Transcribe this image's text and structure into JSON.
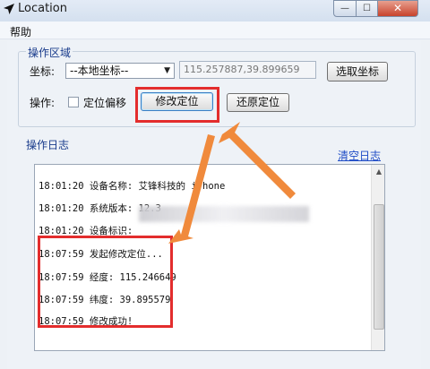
{
  "window": {
    "title": "Location"
  },
  "menu": {
    "help": "帮助"
  },
  "ops": {
    "legend": "操作区域",
    "coord_label": "坐标:",
    "coord_select": "--本地坐标--",
    "coord_value": "115.257887,39.899659",
    "pick_button": "选取坐标",
    "op_label": "操作:",
    "offset_checkbox": "定位偏移",
    "modify_button": "修改定位",
    "restore_button": "还原定位"
  },
  "log": {
    "legend": "操作日志",
    "clear": "清空日志",
    "lines": [
      "18:01:20 设备名称: 艾锋科技的 iPhone",
      "18:01:20 系统版本: 12.3",
      "18:01:20 设备标识:",
      "18:07:59 发起修改定位...",
      "18:07:59 经度: 115.246649",
      "18:07:59 纬度: 39.895579",
      "18:07:59 修改成功!"
    ]
  },
  "colors": {
    "highlight": "#e32d2d",
    "arrow": "#f08a3c"
  }
}
